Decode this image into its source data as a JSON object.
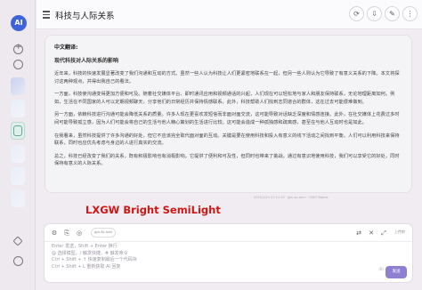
{
  "app": {
    "logo_text": "AI"
  },
  "header": {
    "title": "科技与人际关系",
    "buttons": [
      {
        "name": "refresh-button",
        "glyph": "⟳"
      },
      {
        "name": "download-button",
        "glyph": "⇩"
      },
      {
        "name": "edit-button",
        "glyph": "✎"
      },
      {
        "name": "more-button",
        "glyph": "⋮"
      }
    ]
  },
  "message": {
    "section_label": "中文翻译:",
    "subtitle": "现代科技对人际关系的影响",
    "paragraphs": [
      "近年来，科技的快速发展显著改变了我们沟通和互动的方式。虽然一些人认为科技让人们更紧密地联系在一起，但另一些人则认为它导致了有意义关系的下降。本文将探讨这两种观点，并得出我自己的看法。",
      "一方面，科技使沟通变得更加方便和可及。随着社交媒体平台、即时通讯应用和视频通话的兴起，人们现在可以轻松地与家人和朋友保持联系，无论地理距离如何。例如，生活在不同国家的人可以定期视频聊天，分享他们的日常经历并保持情感联系。此外，科技帮助人们找到志同道合的群体，这在过去可能很难做到。",
      "另一方面，依赖科技进行沟通可能会降低关系的质量。许多人现在更喜欢发短信而非面对面交流，这可能导致对话缺乏深度和情感连接。此外，在社交媒体上花费过多时间可能导致孤立感，因为人们可能会将自己的生活与他人精心策划的生活进行比较。这可能会造成一种孤独感和疏离感，甚至在与他人互动时也是如此。",
      "在我看来，虽然科技提供了许多沟通的好处，但它不应该完全取代面对面的互动。关键是要在使用科技和投入有意义的线下活动之间找到平衡。人们可以利用科技来保持联系，同时也应优先考虑与身边的人进行真实的交流。",
      "总之，科技已经改变了我们的关系，既有积极影响也有消极影响。它提供了便利和可及性，但同时也带来了挑战。通过有意识地使用科技，我们可以享受它的好处，同时保持有意义的人际关系。"
    ],
    "meta": "2025/1/24 21:11:43 · gpt-4o-mini · 1583 Tokens"
  },
  "overlay": {
    "font_label": "LXGW Bright SemiLight"
  },
  "input": {
    "toolbar": [
      {
        "name": "settings-icon",
        "glyph": "⚙"
      },
      {
        "name": "attach-icon",
        "glyph": "⎘"
      },
      {
        "name": "web-icon",
        "glyph": "◎"
      }
    ],
    "model_chip": "gpt-4o-mini",
    "right_tools": [
      {
        "name": "translate-icon",
        "glyph": "⇄"
      },
      {
        "name": "clear-icon",
        "glyph": "✕"
      },
      {
        "name": "expand-icon",
        "glyph": "⤢"
      }
    ],
    "upload_label": "上传附",
    "placeholder_lines": [
      "Enter 发送，Shift + Enter 换行",
      "@ 选择模型，/ 触发快捷，# 触发命令",
      "Ctrl + Shift + ↑ 快速复制最后一个代码块",
      "Ctrl + Shift + L 重新获取 AI 回复"
    ],
    "counter": "(0)",
    "send_label": "发送"
  }
}
